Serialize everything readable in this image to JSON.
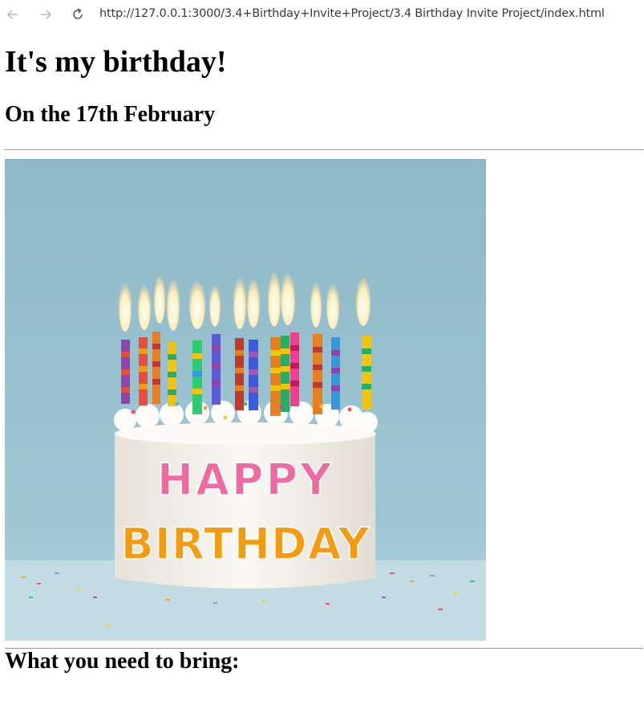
{
  "browser": {
    "url": "http://127.0.0.1:3000/3.4+Birthday+Invite+Project/3.4 Birthday Invite Project/index.html",
    "back_icon": "arrow-left-icon",
    "forward_icon": "arrow-right-icon",
    "reload_icon": "reload-icon"
  },
  "page": {
    "heading": "It's my birthday!",
    "date_heading": "On the 17th February",
    "bring_heading": "What you need to bring:"
  },
  "image": {
    "text_line1": "HAPPY",
    "text_line2": "BIRTHDAY"
  }
}
